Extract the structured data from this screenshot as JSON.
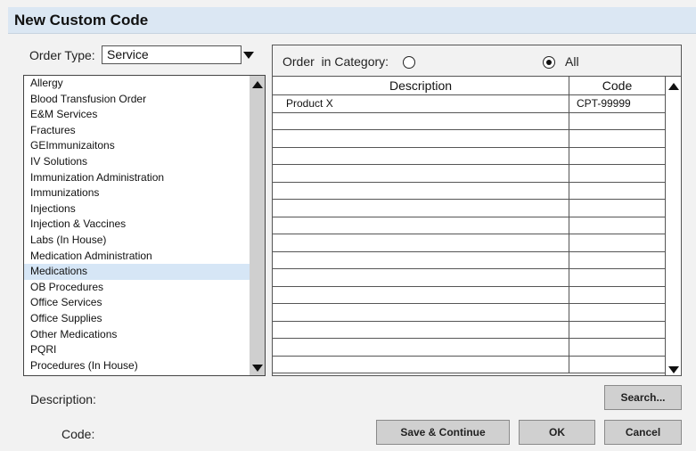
{
  "dialog": {
    "title": "New Custom Code"
  },
  "order_type": {
    "label": "Order Type:",
    "value": "Service"
  },
  "categories": {
    "selected": "Medications",
    "items": [
      "Allergy",
      "Blood Transfusion Order",
      "E&M Services",
      "Fractures",
      "GEImmunizaitons",
      "IV Solutions",
      "Immunization Administration",
      "Immunizations",
      "Injections",
      "Injection & Vaccines",
      "Labs (In House)",
      "Medication Administration",
      "Medications",
      "OB Procedures",
      "Office Services",
      "Office Supplies",
      "Other Medications",
      "PQRI",
      "Procedures (In House)"
    ]
  },
  "filter": {
    "label": "Order  in Category:",
    "all_label": "All",
    "selected": "All"
  },
  "table": {
    "columns": {
      "description": "Description",
      "code": "Code"
    },
    "rows": [
      {
        "description": "Product X",
        "code": "CPT-99999"
      },
      {
        "description": "",
        "code": ""
      },
      {
        "description": "",
        "code": ""
      },
      {
        "description": "",
        "code": ""
      },
      {
        "description": "",
        "code": ""
      },
      {
        "description": "",
        "code": ""
      },
      {
        "description": "",
        "code": ""
      },
      {
        "description": "",
        "code": ""
      },
      {
        "description": "",
        "code": ""
      },
      {
        "description": "",
        "code": ""
      },
      {
        "description": "",
        "code": ""
      },
      {
        "description": "",
        "code": ""
      },
      {
        "description": "",
        "code": ""
      },
      {
        "description": "",
        "code": ""
      },
      {
        "description": "",
        "code": ""
      },
      {
        "description": "",
        "code": ""
      }
    ]
  },
  "form": {
    "description_label": "Description:",
    "code_label": "Code:"
  },
  "buttons": {
    "search": "Search...",
    "save_continue": "Save & Continue",
    "ok": "OK",
    "cancel": "Cancel"
  },
  "colors": {
    "titlebar": "#dbe7f3",
    "selection": "#d6e6f6",
    "button": "#d0d0d0",
    "scrollbar": "#cfcfcf"
  }
}
